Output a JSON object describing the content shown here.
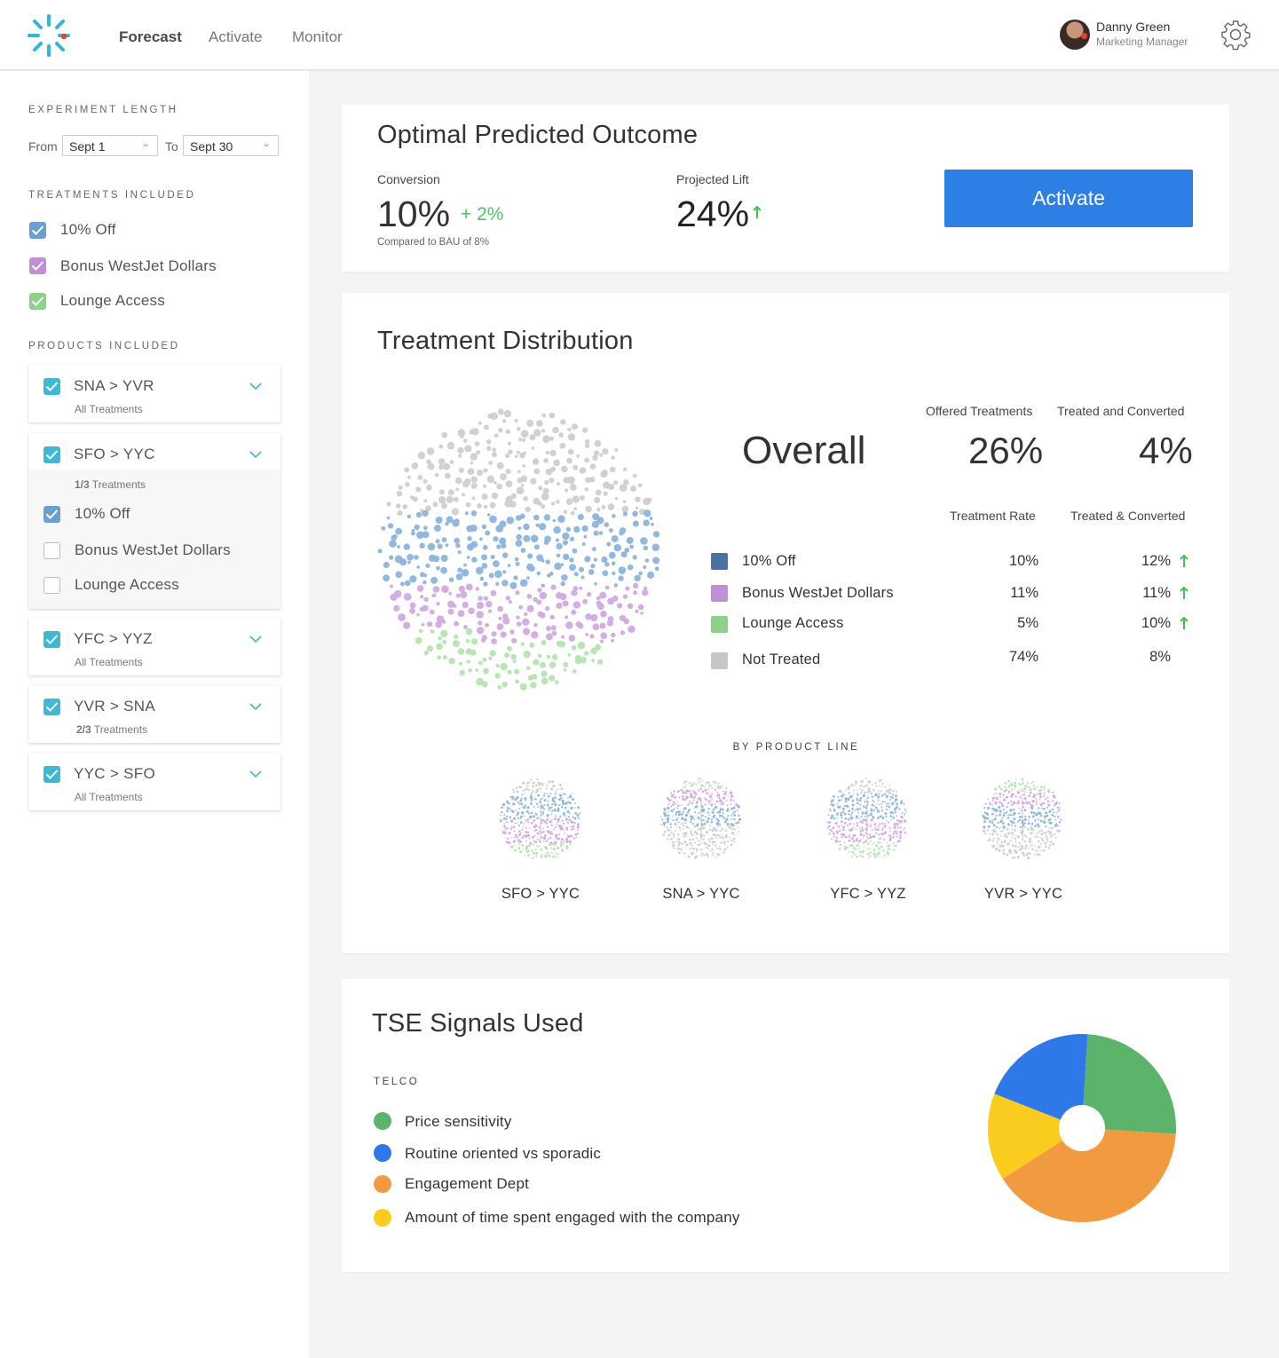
{
  "nav": {
    "items": [
      {
        "label": "Forecast",
        "active": true
      },
      {
        "label": "Activate",
        "active": false
      },
      {
        "label": "Monitor",
        "active": false
      }
    ]
  },
  "user": {
    "name": "Danny Green",
    "role": "Marketing Manager"
  },
  "sidebar": {
    "experiment_title": "EXPERIMENT LENGTH",
    "from_label": "From",
    "from_value": "Sept 1",
    "to_label": "To",
    "to_value": "Sept 30",
    "treatments_title": "TREATMENTS INCLUDED",
    "treatments": [
      {
        "label": "10% Off",
        "color": "#6b9fd4"
      },
      {
        "label": "Bonus WestJet Dollars",
        "color": "#c08fd6"
      },
      {
        "label": "Lounge Access",
        "color": "#8fd18a"
      }
    ],
    "products_title": "PRODUCTS INCLUDED",
    "products": [
      {
        "label": "SNA > YVR",
        "sub": "All Treatments",
        "sub_prefix": ""
      },
      {
        "label": "SFO > YYC",
        "sub": " Treatments",
        "sub_prefix": "1/3",
        "sub_items": [
          {
            "label": "10% Off",
            "checked": true
          },
          {
            "label": "Bonus WestJet Dollars",
            "checked": false
          },
          {
            "label": "Lounge Access",
            "checked": false
          }
        ]
      },
      {
        "label": "YFC > YYZ",
        "sub": "All Treatments",
        "sub_prefix": ""
      },
      {
        "label": "YVR > SNA",
        "sub": " Treatments",
        "sub_prefix": "2/3"
      },
      {
        "label": "YYC > SFO",
        "sub": "All Treatments",
        "sub_prefix": ""
      }
    ]
  },
  "outcome": {
    "title": "Optimal Predicted Outcome",
    "conversion_label": "Conversion",
    "conversion_value": "10%",
    "conversion_delta": "+ 2%",
    "compared": "Compared to BAU of 8%",
    "lift_label": "Projected Lift",
    "lift_value": "24%",
    "activate_label": "Activate"
  },
  "distribution": {
    "title": "Treatment Distribution",
    "offered_label": "Offered Treatments",
    "treated_conv_label": "Treated and Converted",
    "overall_label": "Overall",
    "offered_value": "26%",
    "treated_conv_value": "4%",
    "rate_label": "Treatment Rate",
    "tc_label": "Treated & Converted",
    "rows": [
      {
        "label": "10% Off",
        "rate": "10%",
        "converted": "12%",
        "up": true,
        "color": "#4a72a0"
      },
      {
        "label": "Bonus WestJet Dollars",
        "rate": "11%",
        "converted": "11%",
        "up": true,
        "color": "#c08fd6"
      },
      {
        "label": "Lounge Access",
        "rate": "5%",
        "converted": "10%",
        "up": true,
        "color": "#8fd18a"
      },
      {
        "label": "Not Treated",
        "rate": "74%",
        "converted": "8%",
        "up": false,
        "color": "#c6c6c9"
      }
    ],
    "by_product_title": "BY PRODUCT LINE",
    "products": [
      "SFO > YYC",
      "SNA > YYC",
      "YFC > YYZ",
      "YVR > YYC"
    ]
  },
  "signals": {
    "title": "TSE Signals Used",
    "group": "TELCO",
    "items": [
      {
        "label": "Price sensitivity",
        "color": "#5cb46a"
      },
      {
        "label": "Routine oriented vs sporadic",
        "color": "#2f78e8"
      },
      {
        "label": "Engagement Dept",
        "color": "#f29a40"
      },
      {
        "label": "Amount of time spent engaged with the company",
        "color": "#f9cc1e"
      }
    ]
  },
  "chart_data": {
    "type": "pie",
    "categories": [
      "Price sensitivity",
      "Engagement Dept",
      "Amount of time spent engaged with the company",
      "Routine oriented vs sporadic"
    ],
    "values": [
      25,
      40,
      15,
      20
    ],
    "colors": [
      "#5cb46a",
      "#f29a40",
      "#f9cc1e",
      "#2f78e8"
    ]
  }
}
